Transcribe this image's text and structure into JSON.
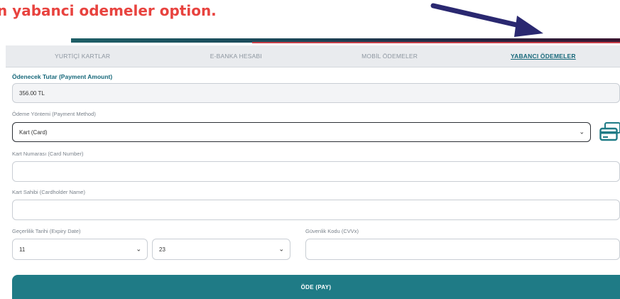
{
  "caption": {
    "text": "n  yabanci odemeler  option."
  },
  "tabs": [
    {
      "label": "YURTİÇİ KARTLAR",
      "active": false
    },
    {
      "label": "E-BANKA HESABI",
      "active": false
    },
    {
      "label": "MOBİL ÖDEMELER",
      "active": false
    },
    {
      "label": "YABANCI ÖDEMELER",
      "active": true
    }
  ],
  "form": {
    "amount_label": "Ödenecek Tutar (Payment Amount)",
    "amount_value": "356.00 TL",
    "method_label": "Ödeme Yöntemi (Payment Method)",
    "method_value": "Kart (Card)",
    "card_number_label": "Kart Numarası (Card Number)",
    "card_number_value": "",
    "cardholder_label": "Kart Sahibi (Cardholder Name)",
    "cardholder_value": "",
    "expiry_label": "Geçerlilik Tarihi (Expiry Date)",
    "expiry_month": "11",
    "expiry_year": "23",
    "cvv_label": "Güvenlik Kodu (CVVx)",
    "cvv_value": ""
  },
  "pay_button": {
    "label": "ÖDE (PAY)"
  },
  "colors": {
    "accent": "#1f7b86",
    "caption": "#e8433f",
    "arrow": "#2a2870"
  },
  "icons": {
    "chevron": "chevron-down-icon",
    "card": "credit-card-icon",
    "arrow": "pointer-arrow-icon"
  }
}
